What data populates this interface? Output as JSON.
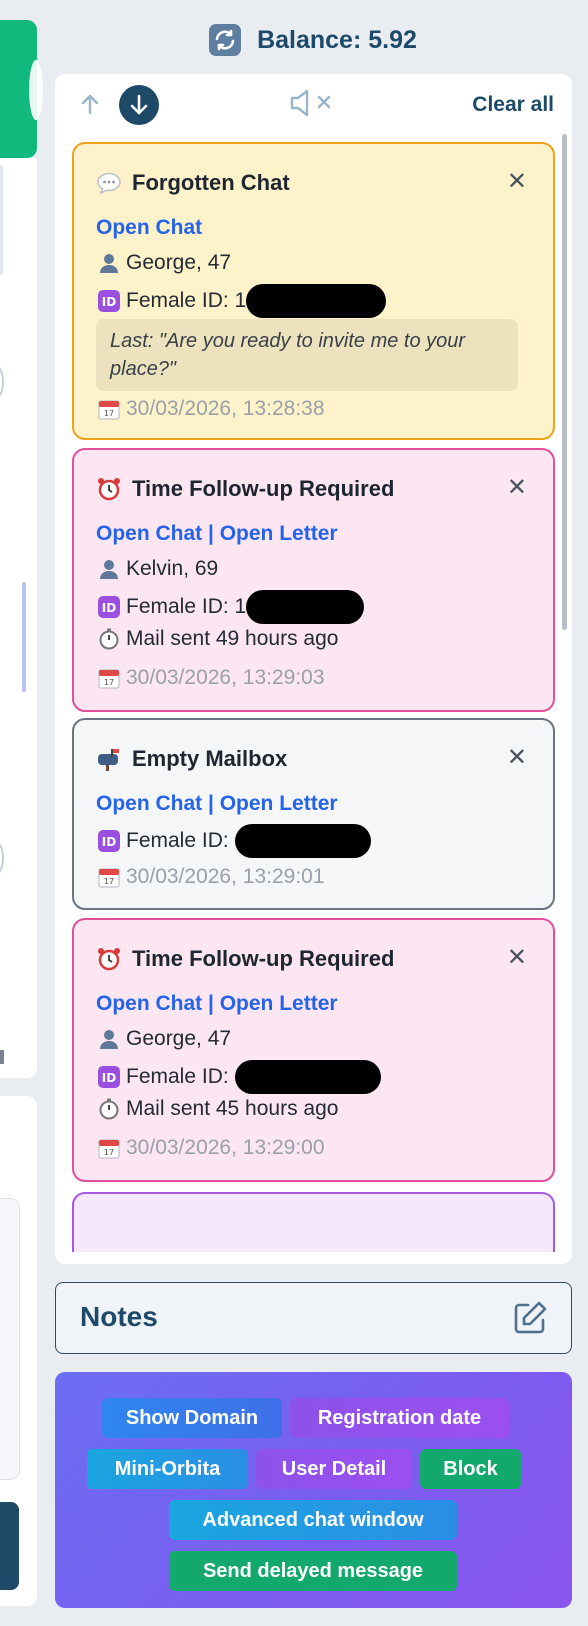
{
  "header": {
    "balance_label": "Balance: 5.92",
    "refresh_icon": "refresh-icon"
  },
  "toolbar": {
    "up_icon": "arrow-up-icon",
    "down_icon": "arrow-down-icon",
    "mute_icon": "speaker-muted-icon",
    "clear_all_label": "Clear all"
  },
  "notifications": [
    {
      "type": "Forgotten Chat",
      "icon": "speech-bubble-icon",
      "color": "#f0a21b",
      "links": [
        "Open Chat"
      ],
      "user": "George, 47",
      "female_id_label": "Female ID: 1",
      "last_message": "Last: \"Are you ready to invite me to your place?\"",
      "timestamp": "30/03/2026, 13:28:38"
    },
    {
      "type": "Time Follow-up Required",
      "icon": "alarm-clock-icon",
      "color": "#e0509b",
      "links": [
        "Open Chat",
        "Open Letter"
      ],
      "user": "Kelvin, 69",
      "female_id_label": "Female ID: 1",
      "mail_status": "Mail sent 49 hours ago",
      "timestamp": "30/03/2026, 13:29:03"
    },
    {
      "type": "Empty Mailbox",
      "icon": "mailbox-icon",
      "color": "#6b7480",
      "links": [
        "Open Chat",
        "Open Letter"
      ],
      "female_id_label": "Female ID:",
      "timestamp": "30/03/2026, 13:29:01"
    },
    {
      "type": "Time Follow-up Required",
      "icon": "alarm-clock-icon",
      "color": "#e0509b",
      "links": [
        "Open Chat",
        "Open Letter"
      ],
      "user": "George, 47",
      "female_id_label": "Female ID:",
      "mail_status": "Mail sent 45 hours ago",
      "timestamp": "30/03/2026, 13:29:00"
    }
  ],
  "link_separator": " | ",
  "notes": {
    "title": "Notes",
    "edit_icon": "edit-icon"
  },
  "actions": {
    "show_domain": "Show Domain",
    "registration_date": "Registration date",
    "mini_orbita": "Mini-Orbita",
    "user_detail": "User Detail",
    "block": "Block",
    "advanced_chat_window": "Advanced chat window",
    "send_delayed_message": "Send delayed message"
  }
}
